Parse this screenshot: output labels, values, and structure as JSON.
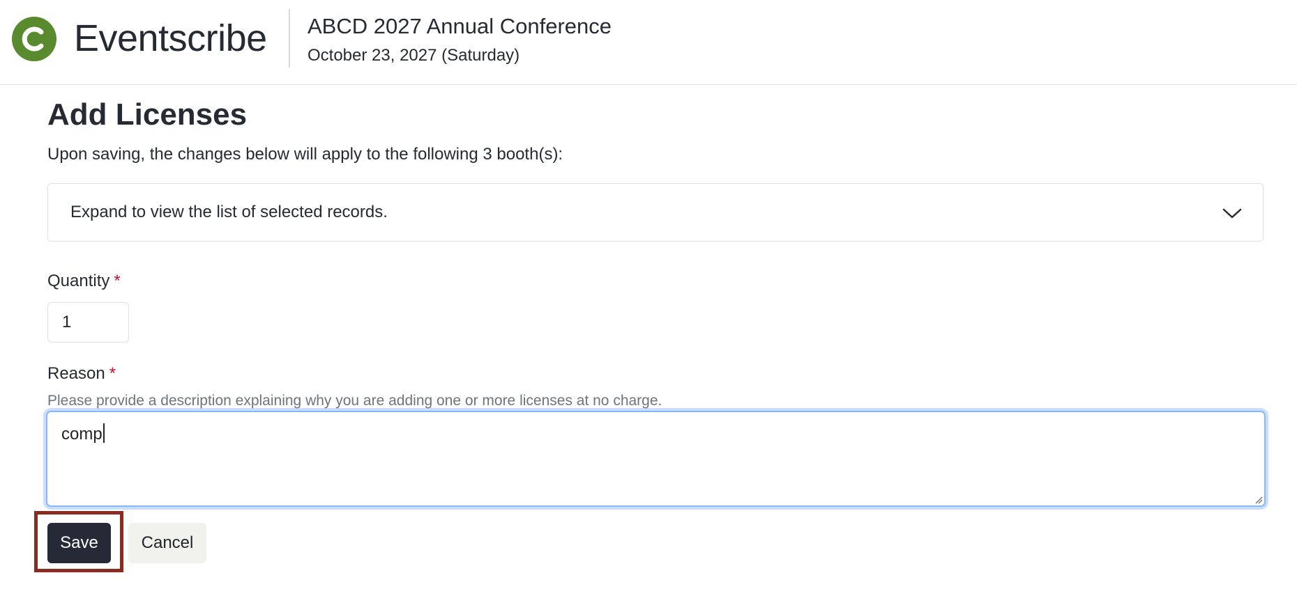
{
  "header": {
    "brand_name": "Eventscribe",
    "brand_color": "#5a8a2e",
    "logo_icon": "c-logo-icon",
    "event_title": "ABCD 2027 Annual Conference",
    "event_date": "October 23, 2027 (Saturday)"
  },
  "page": {
    "title": "Add Licenses",
    "intro": "Upon saving, the changes below will apply to the following 3 booth(s):"
  },
  "accordion": {
    "label": "Expand to view the list of selected records.",
    "icon": "chevron-down-icon"
  },
  "form": {
    "quantity": {
      "label": "Quantity",
      "required_marker": "*",
      "value": "1"
    },
    "reason": {
      "label": "Reason",
      "required_marker": "*",
      "help": "Please provide a description explaining why you are adding one or more licenses at no charge.",
      "value": "comp"
    }
  },
  "actions": {
    "save_label": "Save",
    "cancel_label": "Cancel",
    "save_color": "#252a36",
    "highlight_color": "#8b2a1e"
  }
}
